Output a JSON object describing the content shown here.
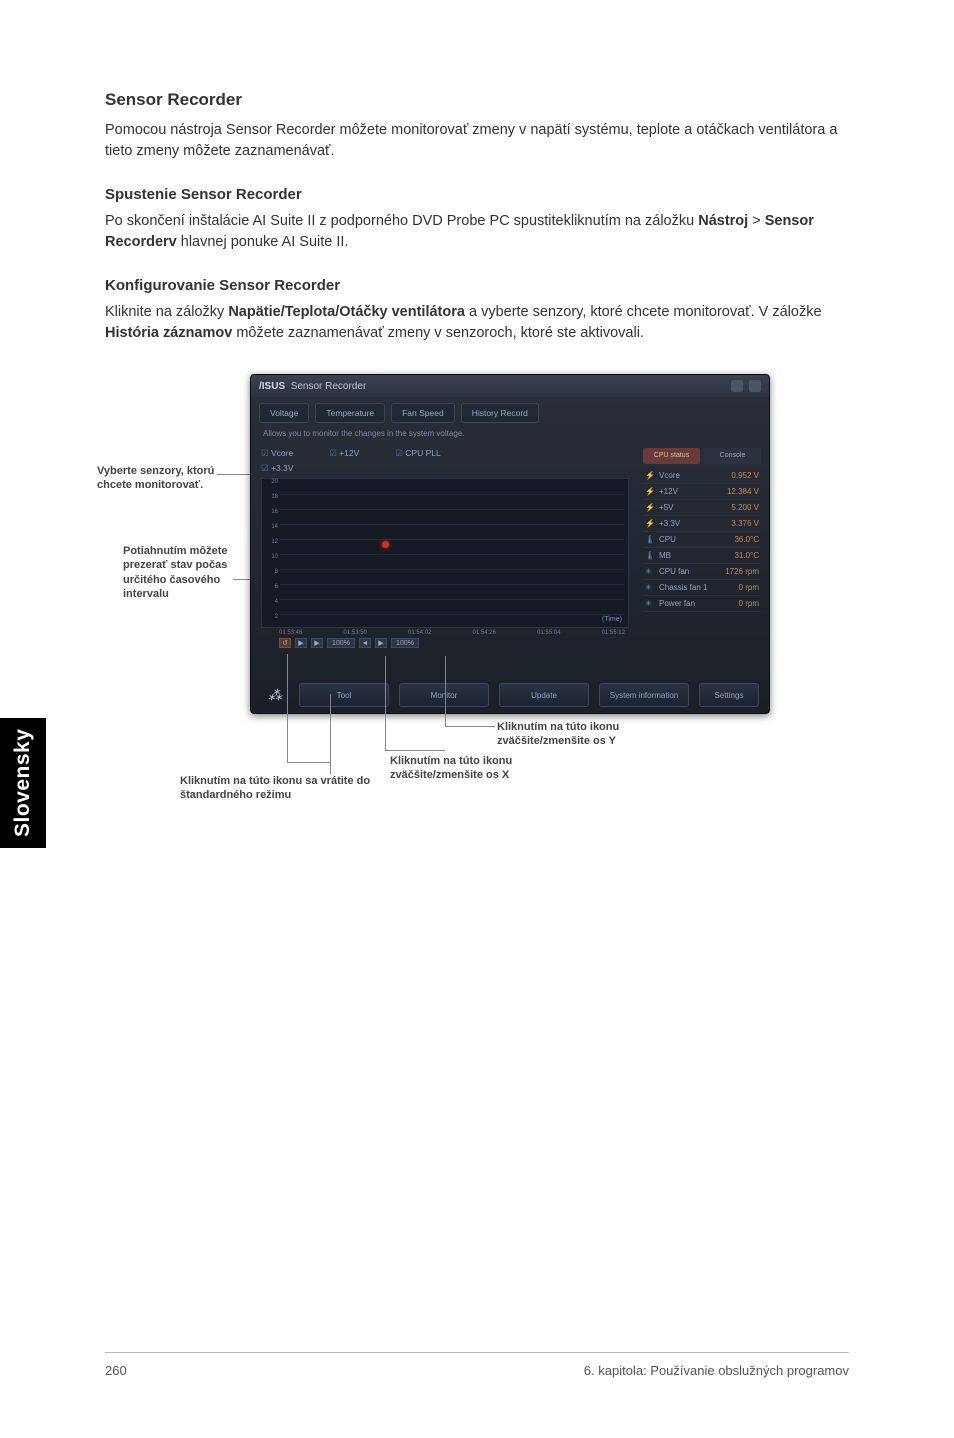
{
  "section": {
    "title": "Sensor Recorder",
    "intro": "Pomocou nástroja Sensor Recorder môžete monitorovať zmeny v napätí systému, teplote a otáčkach ventilátora a tieto zmeny môžete zaznamenávať."
  },
  "launch": {
    "head": "Spustenie Sensor Recorder",
    "text_a": "Po skončení inštalácie AI Suite II z podporného DVD Probe PC spustitekliknutím na záložku ",
    "bold1": "Nástroj",
    "gt": " > ",
    "bold2": "Sensor Recorderv",
    "text_b": " hlavnej ponuke AI Suite II."
  },
  "config": {
    "head": "Konfigurovanie Sensor Recorder",
    "text_a": "Kliknite na záložky ",
    "bold1": "Napätie/Teplota/Otáčky ventilátora",
    "text_b": " a vyberte senzory, ktoré chcete monitorovať. V záložke ",
    "bold2": "História záznamov",
    "text_c": " môžete zaznamenávať zmeny v senzoroch, ktoré ste aktivovali."
  },
  "shot": {
    "title": "Sensor Recorder",
    "tabs": [
      "Voltage",
      "Temperature",
      "Fan Speed",
      "History Record"
    ],
    "desc": "Allows you to monitor the changes in the system voltage.",
    "checks": [
      "Vcore",
      "+12V",
      "CPU PLL"
    ],
    "checks2": [
      "+3.3V"
    ],
    "y": [
      "20",
      "18",
      "16",
      "14",
      "12",
      "10",
      "8",
      "6",
      "4",
      "2"
    ],
    "x": [
      "01:53:46",
      "01:53:50",
      "01:54:02",
      "01:54:26",
      "01:55:04",
      "01:55:12"
    ],
    "time_lbl": "(Time)",
    "ax_zoom": [
      "◄",
      "▶",
      "▶",
      "100%",
      "◄",
      "▶",
      "100%"
    ],
    "btns": [
      "Tool",
      "Monitor",
      "Update",
      "System information",
      "Settings"
    ],
    "side_hdr": [
      "CPU status",
      "Console"
    ],
    "metrics": [
      {
        "ic": "⚡",
        "l": "Vcore",
        "v": "0.952 V"
      },
      {
        "ic": "⚡",
        "l": "+12V",
        "v": "12.384 V"
      },
      {
        "ic": "⚡",
        "l": "+5V",
        "v": "5.200 V"
      },
      {
        "ic": "⚡",
        "l": "+3.3V",
        "v": "3.376 V"
      },
      {
        "ic": "🌡",
        "l": "CPU",
        "v": "36.0°C"
      },
      {
        "ic": "🌡",
        "l": "MB",
        "v": "31.0°C"
      },
      {
        "ic": "✳",
        "l": "CPU fan",
        "v": "1726 rpm"
      },
      {
        "ic": "✳",
        "l": "Chassis fan 1",
        "v": "0 rpm"
      },
      {
        "ic": "✳",
        "l": "Power fan",
        "v": "0 rpm"
      }
    ]
  },
  "callouts": {
    "left1": "Vyberte senzory, ktorú chcete monitorovať.",
    "left2": "Potiahnutím môžete prezerať stav počas určitého časového intervalu",
    "bot1": "Kliknutím na túto ikonu sa vrátite do štandardného režimu",
    "botX": "Kliknutím na túto ikonu zväčšite/zmenšite os X",
    "botY": "Kliknutím na túto ikonu zväčšite/zmenšite os Y"
  },
  "sidetab": "Slovensky",
  "footer": {
    "page": "260",
    "chapter": "6. kapitola: Používanie obslužných programov"
  }
}
